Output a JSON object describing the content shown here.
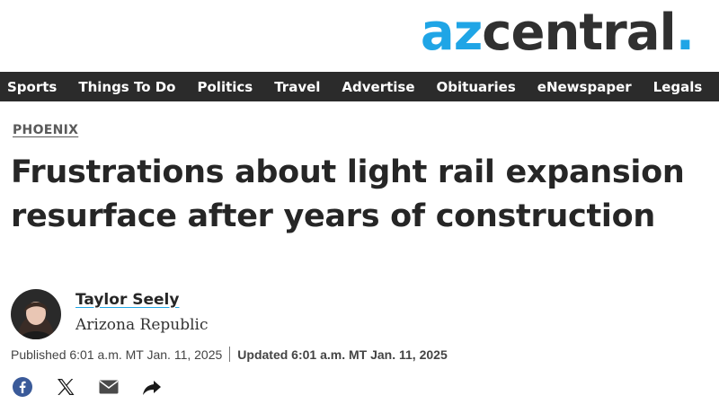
{
  "site": {
    "logo_az": "az",
    "logo_central": "central",
    "logo_dot": ".",
    "brand_blue": "#1fa5e6"
  },
  "nav": {
    "items": [
      "Sports",
      "Things To Do",
      "Politics",
      "Travel",
      "Advertise",
      "Obituaries",
      "eNewspaper",
      "Legals"
    ]
  },
  "article": {
    "section": "PHOENIX",
    "headline": "Frustrations about light rail expansion resurface after years of construction",
    "author": "Taylor Seely",
    "organization": "Arizona Republic",
    "published": "Published 6:01 a.m. MT Jan. 11, 2025",
    "updated": "Updated 6:01 a.m. MT Jan. 11, 2025"
  },
  "share": {
    "icons": [
      "facebook-icon",
      "x-icon",
      "email-icon",
      "share-arrow-icon"
    ]
  }
}
